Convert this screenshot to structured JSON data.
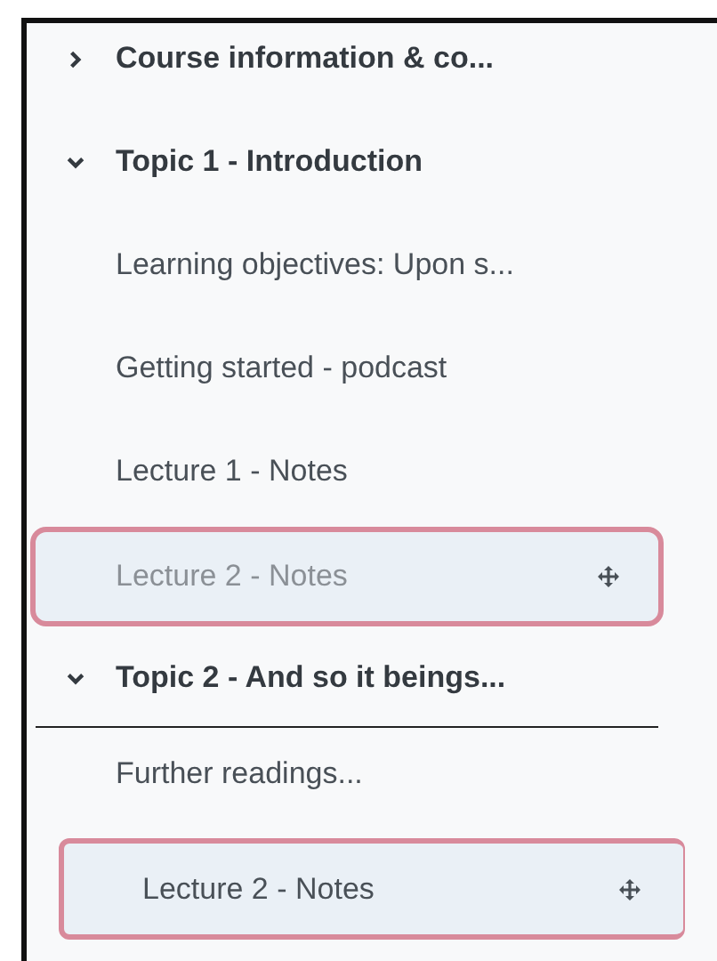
{
  "sections": [
    {
      "title": "Course information & co...",
      "expanded": false,
      "drop_target": false
    },
    {
      "title": "Topic 1 - Introduction",
      "expanded": true,
      "drop_target": false,
      "items": [
        {
          "label": "Learning objectives: Upon s...",
          "dragging": false
        },
        {
          "label": "Getting started - podcast",
          "dragging": false
        },
        {
          "label": "Lecture 1 - Notes",
          "dragging": false
        },
        {
          "label": "Lecture 2 - Notes",
          "dragging": true
        }
      ]
    },
    {
      "title": "Topic 2 - And so it beings...",
      "expanded": true,
      "drop_target": true,
      "items": [
        {
          "label": "Further readings...",
          "dragging": false
        }
      ]
    }
  ],
  "dragged_item": {
    "label": "Lecture 2 - Notes"
  }
}
